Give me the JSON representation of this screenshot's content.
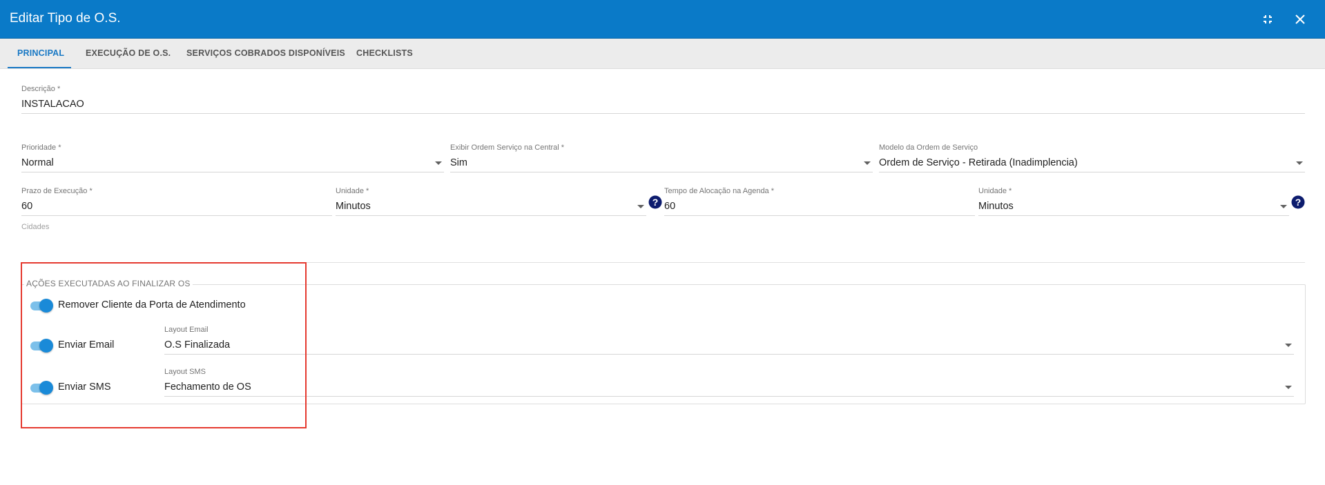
{
  "dialog": {
    "title": "Editar Tipo de O.S.",
    "collapse_icon": "collapse-icon",
    "close_icon": "close-icon"
  },
  "tabs": [
    {
      "label": "PRINCIPAL",
      "active": true
    },
    {
      "label": "EXECUÇÃO DE O.S.",
      "active": false
    },
    {
      "label": "SERVIÇOS COBRADOS DISPONÍVEIS",
      "active": false
    },
    {
      "label": "CHECKLISTS",
      "active": false
    }
  ],
  "form": {
    "descricao": {
      "label": "Descrição *",
      "value": "INSTALACAO"
    },
    "prioridade": {
      "label": "Prioridade *",
      "value": "Normal"
    },
    "exibir_ordem": {
      "label": "Exibir Ordem Serviço na Central *",
      "value": "Sim"
    },
    "modelo_ordem": {
      "label": "Modelo da Ordem de Serviço",
      "value": "Ordem de Serviço - Retirada (Inadimplencia)"
    },
    "prazo_execucao": {
      "label": "Prazo de Execução *",
      "value": "60"
    },
    "unidade_prazo": {
      "label": "Unidade *",
      "value": "Minutos"
    },
    "tempo_alocacao": {
      "label": "Tempo de Alocação na Agenda *",
      "value": "60"
    },
    "unidade_tempo": {
      "label": "Unidade *",
      "value": "Minutos"
    },
    "cidades": {
      "label": "Cidades"
    }
  },
  "acoes": {
    "legend": "AÇÕES EXECUTADAS AO FINALIZAR OS",
    "remover_cliente": {
      "label": "Remover Cliente da Porta de Atendimento",
      "on": true
    },
    "enviar_email": {
      "label": "Enviar Email",
      "on": true,
      "layout_label": "Layout Email",
      "layout_value": "O.S Finalizada"
    },
    "enviar_sms": {
      "label": "Enviar SMS",
      "on": true,
      "layout_label": "Layout SMS",
      "layout_value": "Fechamento de OS"
    }
  },
  "colors": {
    "header": "#0a7ac8",
    "accent": "#1878c4",
    "highlight_box": "#e5392f",
    "help_icon": "#0d1c6e"
  }
}
